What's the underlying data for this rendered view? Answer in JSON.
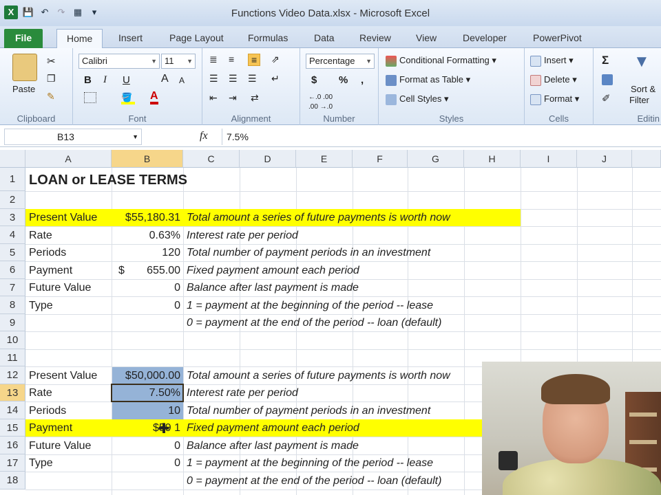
{
  "window": {
    "title": "Functions Video Data.xlsx  -  Microsoft Excel"
  },
  "tabs": [
    "File",
    "Home",
    "Insert",
    "Page Layout",
    "Formulas",
    "Data",
    "Review",
    "View",
    "Developer",
    "PowerPivot"
  ],
  "ribbon": {
    "clipboard": {
      "paste": "Paste",
      "label": "Clipboard"
    },
    "font": {
      "name": "Calibri",
      "size": "11",
      "bold": "B",
      "italic": "I",
      "underline": "U",
      "grow": "A",
      "shrink": "A",
      "label": "Font"
    },
    "alignment": {
      "label": "Alignment"
    },
    "number": {
      "format": "Percentage",
      "currency": "$",
      "percent": "%",
      "comma": ",",
      "inc": "←.0 .00",
      "dec": ".00 →.0",
      "label": "Number"
    },
    "styles": {
      "conditional": "Conditional Formatting",
      "table": "Format as Table",
      "cell": "Cell Styles",
      "label": "Styles"
    },
    "cells": {
      "insert": "Insert",
      "delete": "Delete",
      "format": "Format",
      "label": "Cells"
    },
    "editing": {
      "sigma": "Σ",
      "sort": "Sort &",
      "filter": "Filter",
      "label": "Editin"
    }
  },
  "formula_bar": {
    "name_box": "B13",
    "fx": "fx",
    "value": "7.5%"
  },
  "columns": [
    "A",
    "B",
    "C",
    "D",
    "E",
    "F",
    "G",
    "H",
    "I",
    "J"
  ],
  "rows": [
    "1",
    "2",
    "3",
    "4",
    "5",
    "6",
    "7",
    "8",
    "9",
    "10",
    "11",
    "12",
    "13",
    "14",
    "15",
    "16",
    "17",
    "18"
  ],
  "sheet": {
    "title": "LOAN or LEASE TERMS",
    "block1": [
      {
        "label": "Present Value",
        "value": "$55,180.31",
        "note": "Total amount a series of future payments is worth now"
      },
      {
        "label": "Rate",
        "value": "0.63%",
        "note": "Interest rate per period"
      },
      {
        "label": "Periods",
        "value": "120",
        "note": "Total number of payment periods in an investment"
      },
      {
        "label": "Payment",
        "currency": "$",
        "value": "655.00",
        "note": "Fixed payment amount each period"
      },
      {
        "label": "Future Value",
        "value": "0",
        "note": "Balance after last payment is made"
      },
      {
        "label": "Type",
        "value": "0",
        "note": "1 = payment at the beginning of the period -- lease"
      },
      {
        "label": "",
        "value": "",
        "note": "0 = payment at the end of the period -- loan (default)"
      }
    ],
    "block2": [
      {
        "label": "Present Value",
        "value": "$50,000.00",
        "note": "Total amount a series of future payments is worth now"
      },
      {
        "label": "Rate",
        "value": "7.50%",
        "note": "Interest rate per period"
      },
      {
        "label": "Periods",
        "value": "10",
        "note": "Total number of payment periods in an investment"
      },
      {
        "label": "Payment",
        "value": "$59 1",
        "note": "Fixed payment amount each period"
      },
      {
        "label": "Future Value",
        "value": "0",
        "note": "Balance after last payment is made"
      },
      {
        "label": "Type",
        "value": "0",
        "note": "1 = payment at the beginning of the period -- lease"
      },
      {
        "label": "",
        "value": "",
        "note": "0 = payment at the end of the period -- loan (default)"
      }
    ]
  },
  "colors": {
    "highlight_yellow": "#ffff00",
    "input_blue": "#95b3d7",
    "selected_header": "#f6d68a",
    "file_tab": "#2a8b3c"
  }
}
